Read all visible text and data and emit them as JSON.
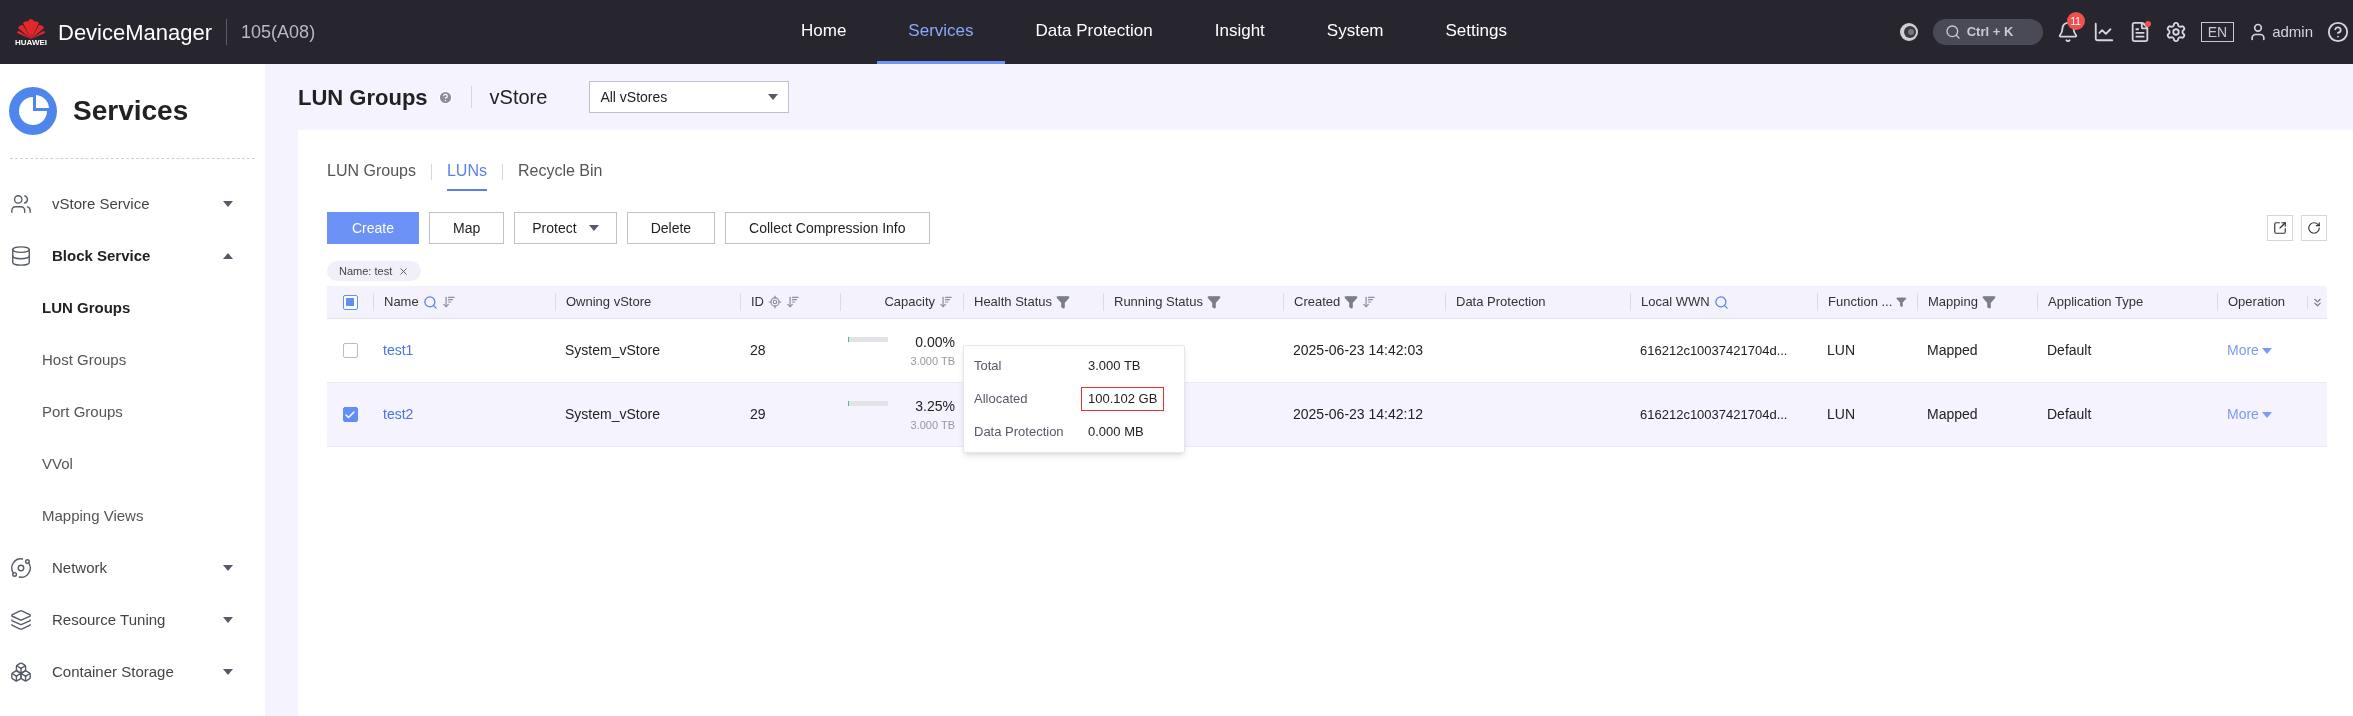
{
  "header": {
    "logo_text": "HUAWEI",
    "brand": "DeviceManager",
    "device": "105(A08)",
    "search_shortcut": "Ctrl + K",
    "notification_count": "11",
    "language": "EN",
    "user": "admin"
  },
  "nav": [
    {
      "label": "Home",
      "selected": false
    },
    {
      "label": "Services",
      "selected": true
    },
    {
      "label": "Data Protection",
      "selected": false
    },
    {
      "label": "Insight",
      "selected": false
    },
    {
      "label": "System",
      "selected": false
    },
    {
      "label": "Settings",
      "selected": false
    }
  ],
  "sidebar": {
    "title": "Services",
    "items": [
      {
        "label": "vStore Service",
        "kind": "users",
        "expanded": false
      },
      {
        "label": "Block Service",
        "kind": "database",
        "expanded": true,
        "children": [
          {
            "label": "LUN Groups",
            "selected": true
          },
          {
            "label": "Host Groups",
            "selected": false
          },
          {
            "label": "Port Groups",
            "selected": false
          },
          {
            "label": "VVol",
            "selected": false
          },
          {
            "label": "Mapping Views",
            "selected": false
          }
        ]
      },
      {
        "label": "Network",
        "kind": "orbit",
        "expanded": false
      },
      {
        "label": "Resource Tuning",
        "kind": "layers",
        "expanded": false
      },
      {
        "label": "Container Storage",
        "kind": "boxes",
        "expanded": false
      }
    ]
  },
  "page": {
    "title": "LUN Groups",
    "vstore_label": "vStore",
    "vstore_select": "All vStores"
  },
  "tabs": [
    {
      "label": "LUN Groups",
      "selected": false
    },
    {
      "label": "LUNs",
      "selected": true
    },
    {
      "label": "Recycle Bin",
      "selected": false
    }
  ],
  "toolbar": [
    {
      "label": "Create",
      "kind": "primary"
    },
    {
      "label": "Map",
      "kind": "plain"
    },
    {
      "label": "Protect",
      "kind": "dropdown"
    },
    {
      "label": "Delete",
      "kind": "plain"
    },
    {
      "label": "Collect Compression Info",
      "kind": "plain"
    }
  ],
  "filter_chip": "Name: test",
  "table": {
    "select_all_indeterminate": true,
    "columns": [
      "Name",
      "Owning vStore",
      "ID",
      "Capacity",
      "Health Status",
      "Running Status",
      "Created",
      "Data Protection",
      "Local WWN",
      "Function ...",
      "Mapping",
      "Application Type",
      "Operation"
    ],
    "rows": [
      {
        "selected": false,
        "name": "test1",
        "owning_vstore": "System_vStore",
        "id": "28",
        "capacity_percent": "0.00%",
        "capacity_total": "3.000 TB",
        "level": 0,
        "created": "2025-06-23 14:42:03",
        "wwn": "616212c10037421704d...",
        "function": "LUN",
        "mapping": "Mapped",
        "application_type": "Default",
        "operation": "More"
      },
      {
        "selected": true,
        "name": "test2",
        "owning_vstore": "System_vStore",
        "id": "29",
        "capacity_percent": "3.25%",
        "capacity_total": "3.000 TB",
        "level": 0.0325,
        "created": "2025-06-23 14:42:12",
        "wwn": "616212c10037421704d...",
        "function": "LUN",
        "mapping": "Mapped",
        "application_type": "Default",
        "operation": "More"
      }
    ]
  },
  "tooltip": {
    "rows": [
      {
        "label": "Total",
        "value": "3.000 TB",
        "highlighted": false
      },
      {
        "label": "Allocated",
        "value": "100.102 GB",
        "highlighted": true
      },
      {
        "label": "Data Protection",
        "value": "0.000 MB",
        "highlighted": false
      }
    ]
  }
}
